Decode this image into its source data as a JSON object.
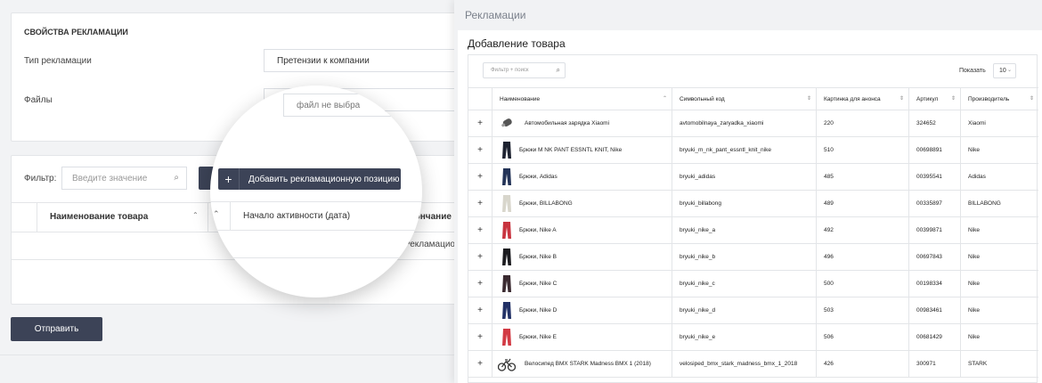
{
  "left": {
    "properties_title": "СВОЙСТВА РЕКЛАМАЦИИ",
    "type_label": "Тип рекламации",
    "type_value": "Претензии к компании",
    "files_label": "Файлы",
    "file_placeholder": "файл не выбра",
    "filter_label": "Фильтр:",
    "filter_placeholder": "Введите значение",
    "col_name": "Наименование товара",
    "col_end": "Окончание ак",
    "row_text": "Рекламацион",
    "send_button": "Отправить"
  },
  "zoom": {
    "add_button": "Добавить рекламационную позицию",
    "col_start": "Начало активности (дата)"
  },
  "panel": {
    "title": "Рекламации",
    "subtitle": "Добавление товара",
    "search_placeholder": "Фильтр + поиск",
    "show_label": "Показать",
    "show_value": "10",
    "headers": [
      "Наименование",
      "Символьный код",
      "Картинка для анонса",
      "Артикул",
      "Производитель"
    ],
    "rows": [
      {
        "name": "Автомобильная зарядка Xiaomi",
        "code": "avtomobilnaya_zaryadka_xiaomi",
        "pic": "220",
        "sku": "324652",
        "brand": "Xiaomi",
        "thumb": "charger",
        "color": "#555"
      },
      {
        "name": "Брюки M NK PANT ESSNTL KNIT, Nike",
        "code": "bryuki_m_nk_pant_essntl_knit_nike",
        "pic": "510",
        "sku": "00698891",
        "brand": "Nike",
        "thumb": "pants",
        "color": "#1d2230"
      },
      {
        "name": "Брюки, Adidas",
        "code": "bryuki_adidas",
        "pic": "485",
        "sku": "00395541",
        "brand": "Adidas",
        "thumb": "pants",
        "color": "#233357"
      },
      {
        "name": "Брюки, BILLABONG",
        "code": "bryuki_billabong",
        "pic": "489",
        "sku": "00335897",
        "brand": "BILLABONG",
        "thumb": "pants",
        "color": "#d8d6cc"
      },
      {
        "name": "Брюки, Nike A",
        "code": "bryuki_nike_a",
        "pic": "492",
        "sku": "00399871",
        "brand": "Nike",
        "thumb": "pants",
        "color": "#c8343f"
      },
      {
        "name": "Брюки, Nike B",
        "code": "bryuki_nike_b",
        "pic": "496",
        "sku": "00697843",
        "brand": "Nike",
        "thumb": "pants",
        "color": "#1b1b1f"
      },
      {
        "name": "Брюки, Nike C",
        "code": "bryuki_nike_c",
        "pic": "500",
        "sku": "00198334",
        "brand": "Nike",
        "thumb": "pants",
        "color": "#3a2a30"
      },
      {
        "name": "Брюки, Nike D",
        "code": "bryuki_nike_d",
        "pic": "503",
        "sku": "00983461",
        "brand": "Nike",
        "thumb": "pants",
        "color": "#223166"
      },
      {
        "name": "Брюки, Nike E",
        "code": "bryuki_nike_e",
        "pic": "506",
        "sku": "00681429",
        "brand": "Nike",
        "thumb": "pants",
        "color": "#d23a44"
      },
      {
        "name": "Велосипед BMX STARK Madness BMX 1 (2018)",
        "code": "velosiped_bmx_stark_madness_bmx_1_2018",
        "pic": "426",
        "sku": "300971",
        "brand": "STARK",
        "thumb": "bike",
        "color": "#333"
      }
    ]
  }
}
